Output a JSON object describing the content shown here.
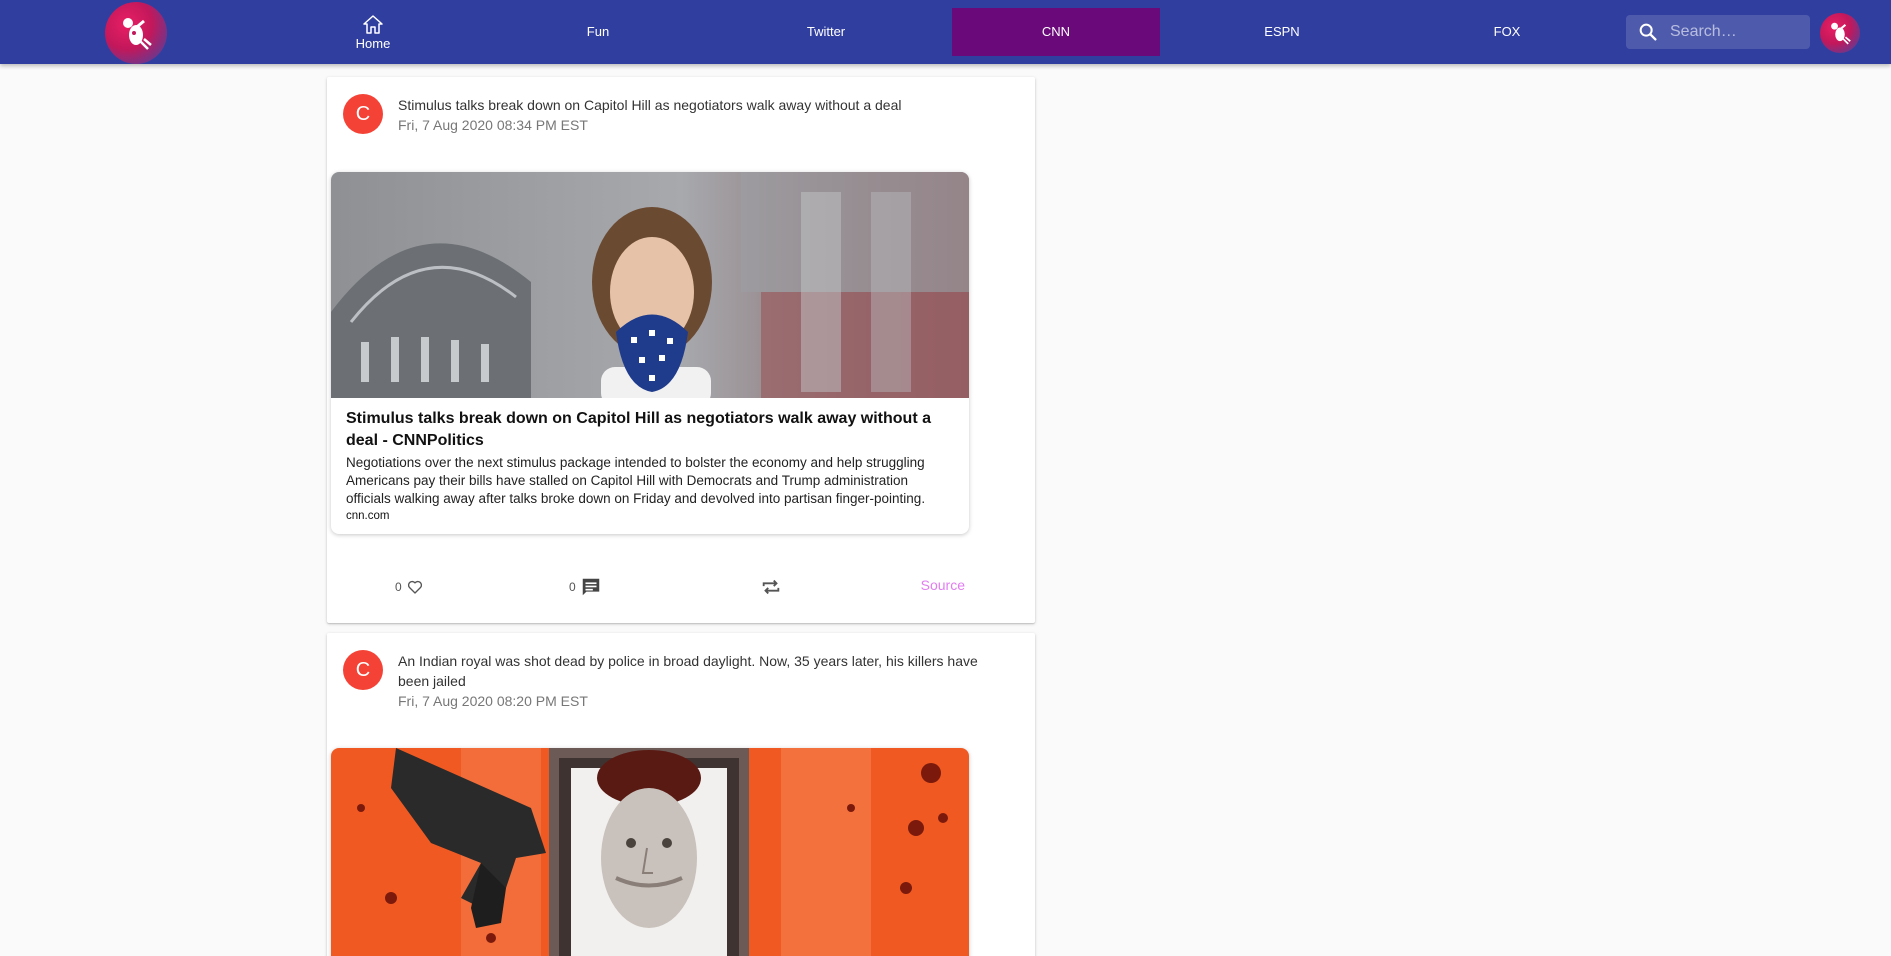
{
  "nav": {
    "tabs": [
      {
        "label": "Home",
        "icon": "home-icon"
      },
      {
        "label": "Fun"
      },
      {
        "label": "Twitter"
      },
      {
        "label": "CNN",
        "active": true
      },
      {
        "label": "ESPN"
      },
      {
        "label": "FOX"
      }
    ],
    "search_placeholder": "Search…"
  },
  "colors": {
    "appbar": "#303f9f",
    "active_tab": "#6a0a7a",
    "card_avatar": "#f44336",
    "source_link": "#e07ef0"
  },
  "posts": [
    {
      "avatar_letter": "C",
      "title": "Stimulus talks break down on Capitol Hill as negotiators walk away without a deal",
      "date": "Fri, 7 Aug 2020 08:34 PM EST",
      "preview": {
        "title": "Stimulus talks break down on Capitol Hill as negotiators walk away without a deal - CNNPolitics",
        "description": "Negotiations over the next stimulus package intended to bolster the economy and help struggling Americans pay their bills have stalled on Capitol Hill with Democrats and Trump administration officials walking away after talks broke down on Friday and devolved into partisan finger-pointing.",
        "domain": "cnn.com"
      },
      "likes": "0",
      "comments": "0",
      "source_label": "Source"
    },
    {
      "avatar_letter": "C",
      "title": "An Indian royal was shot dead by police in broad daylight. Now, 35 years later, his killers have been jailed",
      "date": "Fri, 7 Aug 2020 08:20 PM EST"
    }
  ]
}
